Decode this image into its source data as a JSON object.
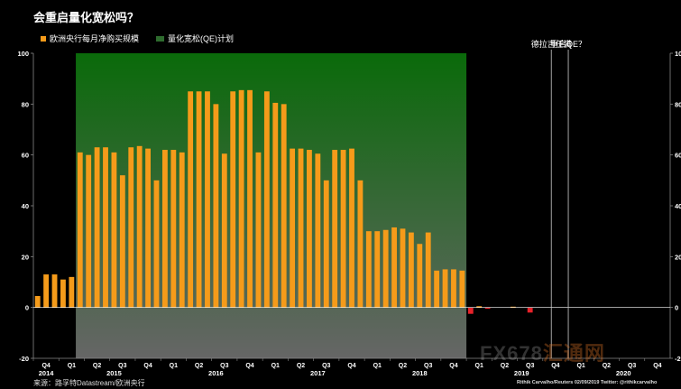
{
  "title": "会重启量化宽松吗？",
  "source": "来源：路孚特Datastream/欧洲央行",
  "credit": "Rithik Carvalho/Reuters 02/09/2019 Twitter: @rithikcarvalho",
  "watermark": {
    "main": "FX678",
    "accent": "汇通网"
  },
  "colors": {
    "bar_positive": "#f59b1a",
    "bar_negative": "#e8222a",
    "qe_top": "#0a6a0a",
    "qe_bottom": "#666666",
    "annotation_line": "#cccccc",
    "zero_line": "#ffffff"
  },
  "chart_data": {
    "type": "bar",
    "ylim": [
      -20,
      100
    ],
    "yticks": [
      -20,
      0,
      20,
      40,
      60,
      80,
      100
    ],
    "legend": [
      {
        "label": "欧洲央行每月净购买规模",
        "color": "#f59b1a"
      },
      {
        "label": "量化宽松(QE)计划",
        "color": "#2e6b2e"
      }
    ],
    "x_month_range": [
      "2014-10",
      "2020-12"
    ],
    "quarter_ticks": [
      "Q4",
      "Q1",
      "Q2",
      "Q3",
      "Q4",
      "Q1",
      "Q2",
      "Q3",
      "Q4",
      "Q1",
      "Q2",
      "Q3",
      "Q4",
      "Q1",
      "Q2",
      "Q3",
      "Q4",
      "Q1",
      "Q2",
      "Q3",
      "Q4",
      "Q1",
      "Q2",
      "Q3",
      "Q4"
    ],
    "year_labels": [
      {
        "label": "2014",
        "month": "2014-11"
      },
      {
        "label": "2015",
        "month": "2015-07"
      },
      {
        "label": "2016",
        "month": "2016-07"
      },
      {
        "label": "2017",
        "month": "2017-07"
      },
      {
        "label": "2018",
        "month": "2018-07"
      },
      {
        "label": "2019",
        "month": "2019-07"
      },
      {
        "label": "2020",
        "month": "2020-07"
      }
    ],
    "qe_program": {
      "start": "2015-03",
      "end": "2018-12"
    },
    "annotations": [
      {
        "label": "德拉吉任满",
        "month": "2019-11"
      },
      {
        "label": "重启QE？",
        "month": "2020-01"
      }
    ],
    "months": [
      "2014-10",
      "2014-11",
      "2014-12",
      "2015-01",
      "2015-02",
      "2015-03",
      "2015-04",
      "2015-05",
      "2015-06",
      "2015-07",
      "2015-08",
      "2015-09",
      "2015-10",
      "2015-11",
      "2015-12",
      "2016-01",
      "2016-02",
      "2016-03",
      "2016-04",
      "2016-05",
      "2016-06",
      "2016-07",
      "2016-08",
      "2016-09",
      "2016-10",
      "2016-11",
      "2016-12",
      "2017-01",
      "2017-02",
      "2017-03",
      "2017-04",
      "2017-05",
      "2017-06",
      "2017-07",
      "2017-08",
      "2017-09",
      "2017-10",
      "2017-11",
      "2017-12",
      "2018-01",
      "2018-02",
      "2018-03",
      "2018-04",
      "2018-05",
      "2018-06",
      "2018-07",
      "2018-08",
      "2018-09",
      "2018-10",
      "2018-11",
      "2018-12",
      "2019-01",
      "2019-02",
      "2019-03",
      "2019-04",
      "2019-05",
      "2019-06",
      "2019-07",
      "2019-08"
    ],
    "values": [
      4.5,
      13,
      13,
      11,
      12,
      61,
      60,
      63,
      63,
      61,
      52,
      63,
      63.5,
      62.5,
      50,
      62,
      62,
      61,
      85,
      85,
      85,
      80,
      60.5,
      85,
      85.5,
      85.5,
      61,
      85,
      80.5,
      80,
      62.5,
      62.5,
      62,
      60.5,
      50,
      62,
      62,
      62.5,
      50,
      30,
      30,
      30.5,
      31.5,
      31,
      29.5,
      25,
      29.5,
      14.5,
      15,
      15,
      14.5,
      -2.5,
      0.5,
      -0.5,
      0,
      0,
      0.3,
      0,
      -2
    ]
  }
}
